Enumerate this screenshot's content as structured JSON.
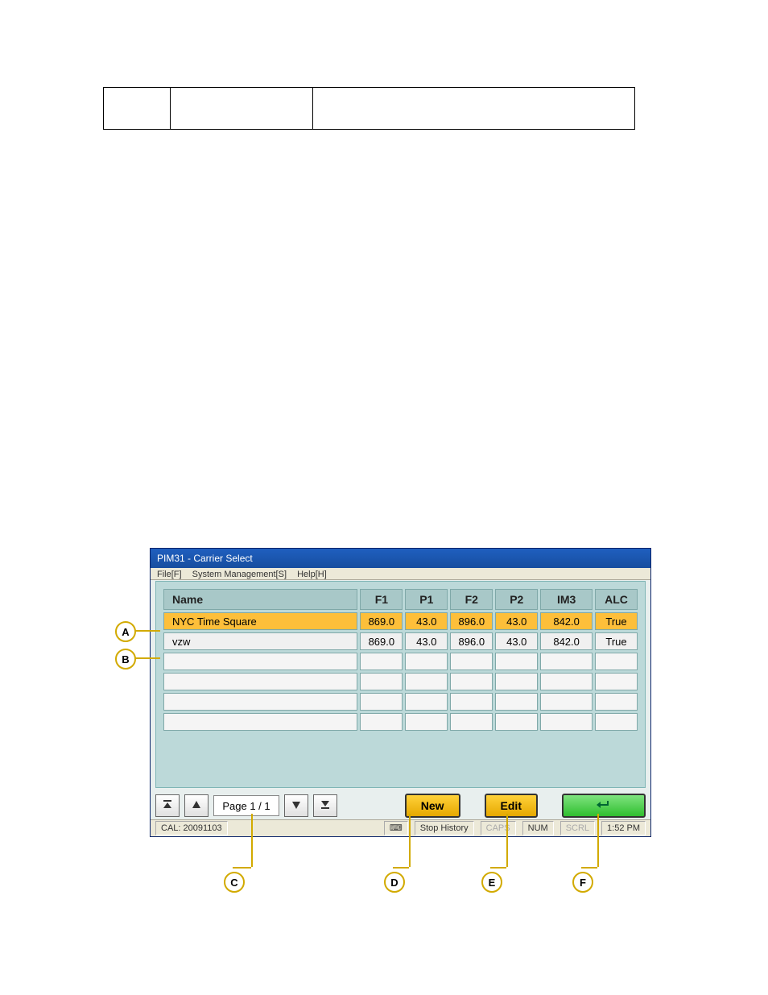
{
  "top_table": {
    "c1": "",
    "c2": "",
    "c3": ""
  },
  "window": {
    "title": "PIM31 - Carrier Select",
    "menu": {
      "file": "File[F]",
      "system": "System Management[S]",
      "help": "Help[H]"
    }
  },
  "table": {
    "headers": {
      "name": "Name",
      "f1": "F1",
      "p1": "P1",
      "f2": "F2",
      "p2": "P2",
      "im3": "IM3",
      "alc": "ALC"
    },
    "rows": [
      {
        "name": "NYC Time Square",
        "f1": "869.0",
        "p1": "43.0",
        "f2": "896.0",
        "p2": "43.0",
        "im3": "842.0",
        "alc": "True",
        "highlight": true
      },
      {
        "name": "vzw",
        "f1": "869.0",
        "p1": "43.0",
        "f2": "896.0",
        "p2": "43.0",
        "im3": "842.0",
        "alc": "True",
        "highlight": false
      }
    ],
    "empty_rows": 4
  },
  "pager": {
    "label": "Page 1 / 1"
  },
  "buttons": {
    "new": "New",
    "edit": "Edit",
    "return_icon": "↵"
  },
  "status": {
    "cal": "CAL: 20091103",
    "history": "Stop History",
    "caps": "CAPS",
    "num": "NUM",
    "scrl": "SCRL",
    "time": "1:52 PM"
  },
  "callouts": {
    "A": "A",
    "B": "B",
    "C": "C",
    "D": "D",
    "E": "E",
    "F": "F"
  }
}
